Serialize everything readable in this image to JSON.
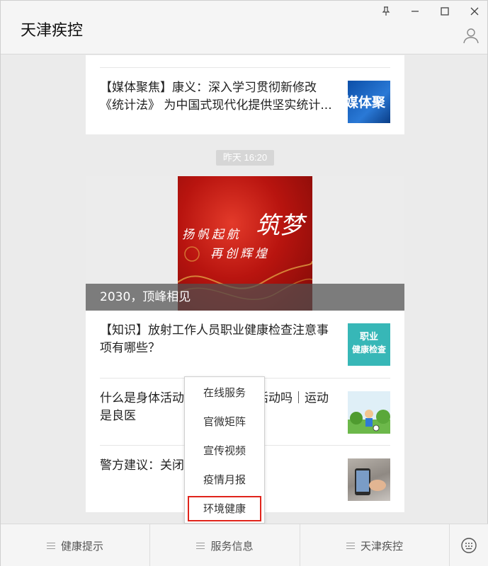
{
  "window": {
    "title": "天津疾控",
    "controls": [
      "pin-icon",
      "minimize-icon",
      "maximize-icon",
      "close-icon"
    ]
  },
  "feed": {
    "top_card": {
      "title": "【媒体聚焦】康义：深入学习贯彻新修改《统计法》 为中国式现代化提供坚实统计...",
      "thumb_text": "媒体聚"
    },
    "timestamp": "昨天 16:20",
    "hero": {
      "image_text_line1": "扬帆起航",
      "image_text_big": "筑梦",
      "image_text_line2": "再创辉煌",
      "caption": "2030，顶峰相见"
    },
    "articles": [
      {
        "title": "【知识】放射工作人员职业健康检查注意事项有哪些？",
        "thumb_line1": "职业",
        "thumb_line2": "健康检查"
      },
      {
        "title": "什么是身体活动？您知道体育活动吗｜运动是良医"
      },
      {
        "title": "警方建议：关闭这几个功能！"
      }
    ]
  },
  "menu_popup": {
    "items": [
      "在线服务",
      "官微矩阵",
      "宣传视频",
      "疫情月报",
      "环境健康"
    ],
    "selected_index": 4,
    "highlight_color": "#e0241b"
  },
  "bottom_menu": {
    "tabs": [
      "健康提示",
      "服务信息",
      "天津疾控"
    ]
  }
}
